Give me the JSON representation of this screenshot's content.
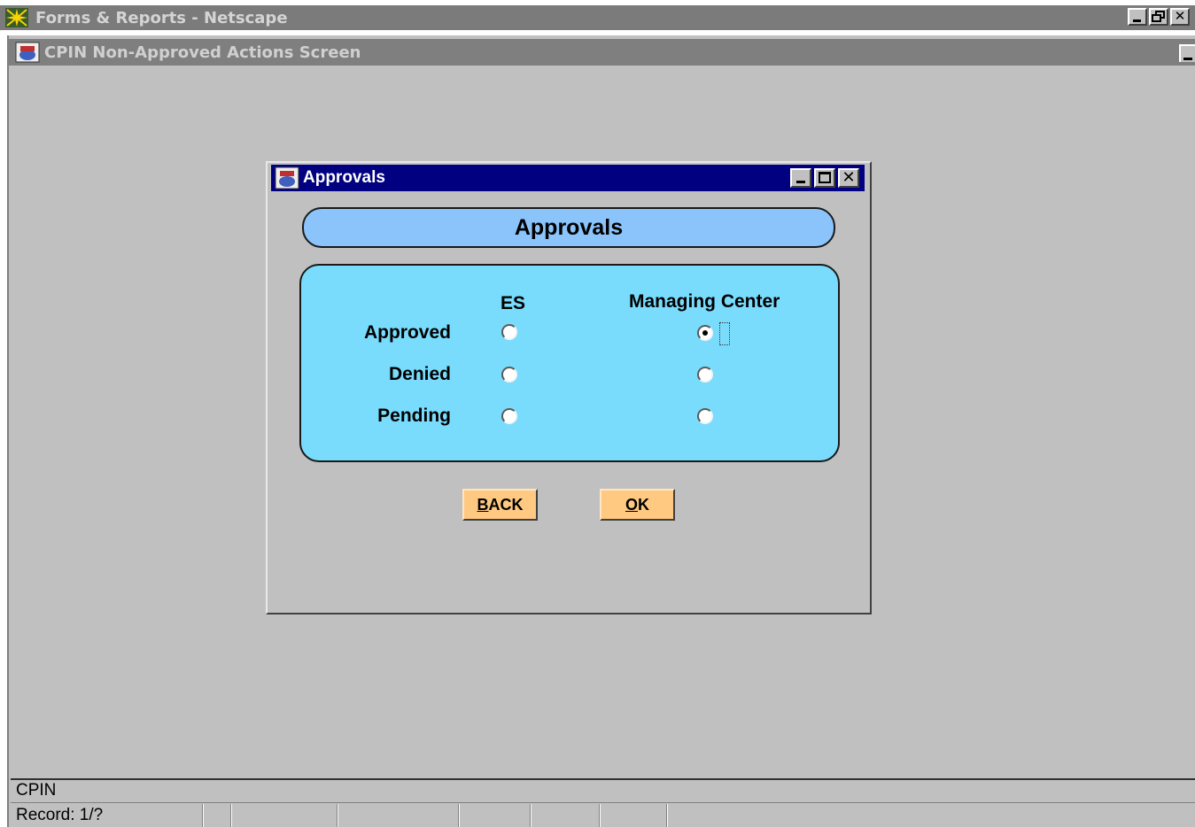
{
  "browser": {
    "title": "Forms & Reports - Netscape",
    "controls": [
      "_",
      "▣",
      "X"
    ]
  },
  "screen": {
    "title": "CPIN Non-Approved Actions Screen"
  },
  "dialog": {
    "title": "Approvals",
    "header": "Approvals",
    "columns": {
      "es": "ES",
      "managing_center": "Managing Center"
    },
    "rows": {
      "approved": "Approved",
      "denied": "Denied",
      "pending": "Pending"
    },
    "selection": {
      "es": "none",
      "managing_center": "Approved"
    },
    "buttons": {
      "back_hotkey": "B",
      "back_rest": "ACK",
      "ok_hotkey": "O",
      "ok_rest": "K"
    }
  },
  "status": {
    "app": "CPIN",
    "record": "Record: 1/?"
  },
  "colors": {
    "dialog_title_bar": "#000080",
    "header_pill": "#8ac4fb",
    "panel": "#79dcfc",
    "buttons": "#ffc981",
    "window_bg": "#c0c0c0"
  }
}
